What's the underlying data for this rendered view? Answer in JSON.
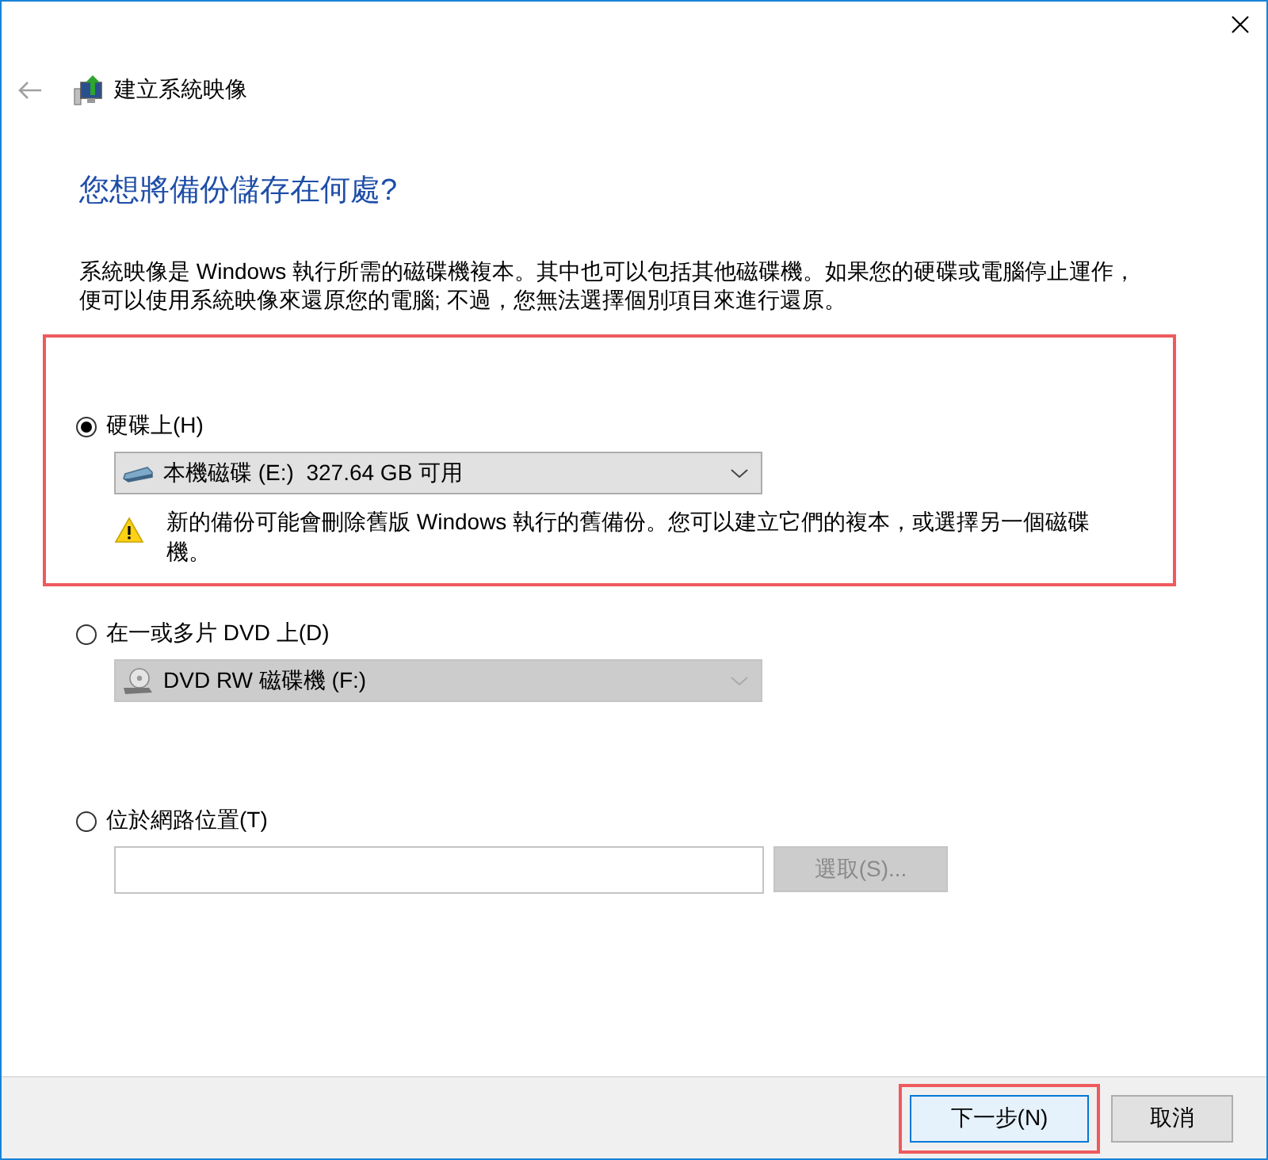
{
  "header": {
    "title": "建立系統映像"
  },
  "heading": "您想將備份儲存在何處?",
  "description": "系統映像是 Windows 執行所需的磁碟機複本。其中也可以包括其他磁碟機。如果您的硬碟或電腦停止運作，便可以使用系統映像來還原您的電腦; 不過，您無法選擇個別項目來進行還原。",
  "destinations": [
    {
      "kind": "hard-drive",
      "label": "硬碟上(H)",
      "selected": true,
      "highlighted": true,
      "drive": {
        "value": "本機磁碟 (E:)  327.64 GB 可用",
        "disabled": false
      },
      "warning": "新的備份可能會刪除舊版 Windows 執行的舊備份。您可以建立它們的複本，或選擇另一個磁碟機。"
    },
    {
      "kind": "dvd",
      "label": "在一或多片 DVD 上(D)",
      "selected": false,
      "highlighted": false,
      "drive": {
        "value": "DVD RW 磁碟機 (F:)",
        "disabled": true
      }
    },
    {
      "kind": "network",
      "label": "位於網路位置(T)",
      "selected": false,
      "highlighted": false,
      "browse_button": {
        "label": "選取(S)...",
        "disabled": true
      }
    }
  ],
  "buttons": [
    {
      "label": "下一步(N)",
      "default": true,
      "highlighted": true
    },
    {
      "label": "取消",
      "default": false,
      "highlighted": false
    }
  ]
}
